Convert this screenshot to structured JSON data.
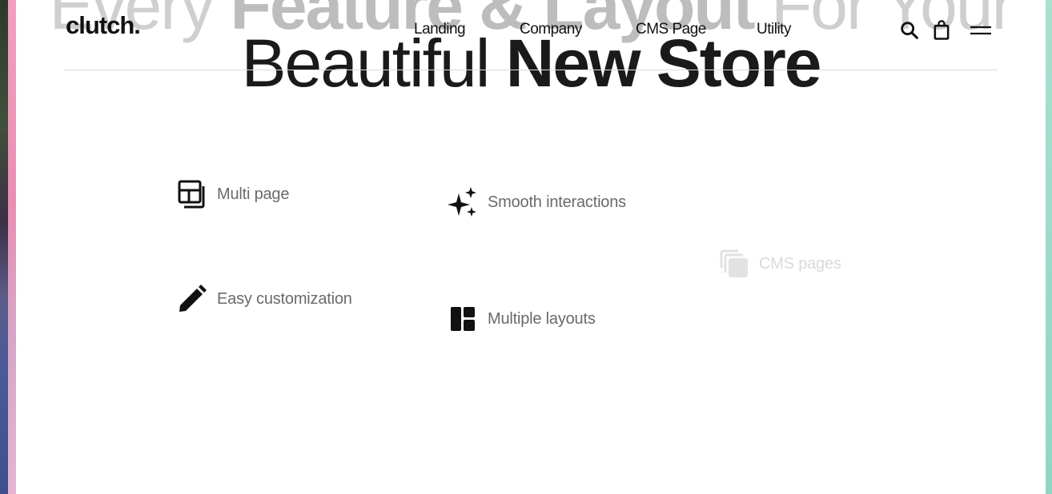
{
  "brand": {
    "logo": "clutch."
  },
  "nav": {
    "items": [
      {
        "label": "Landing"
      },
      {
        "label": "Company"
      },
      {
        "label": "CMS Page"
      },
      {
        "label": "Utility"
      }
    ]
  },
  "header_icons": [
    "search-icon",
    "shopping-bag-icon",
    "menu-icon"
  ],
  "hero": {
    "line1_light_a": "Every ",
    "line1_bold": "Feature & Layout",
    "line1_light_b": " For Your",
    "line2_light": "Beautiful ",
    "line2_bold": "New Store"
  },
  "features": [
    {
      "label": "Multi page",
      "icon": "multi-page-icon"
    },
    {
      "label": "Smooth interactions",
      "icon": "sparkle-icon"
    },
    {
      "label": "CMS pages",
      "icon": "pages-stack-icon"
    },
    {
      "label": "Easy customization",
      "icon": "pencil-icon"
    },
    {
      "label": "Multiple layouts",
      "icon": "layout-icon"
    }
  ],
  "colors": {
    "accent_left": "#e98fb3",
    "accent_right": "#8fd6c6",
    "text_muted": "#6a6a6a"
  }
}
